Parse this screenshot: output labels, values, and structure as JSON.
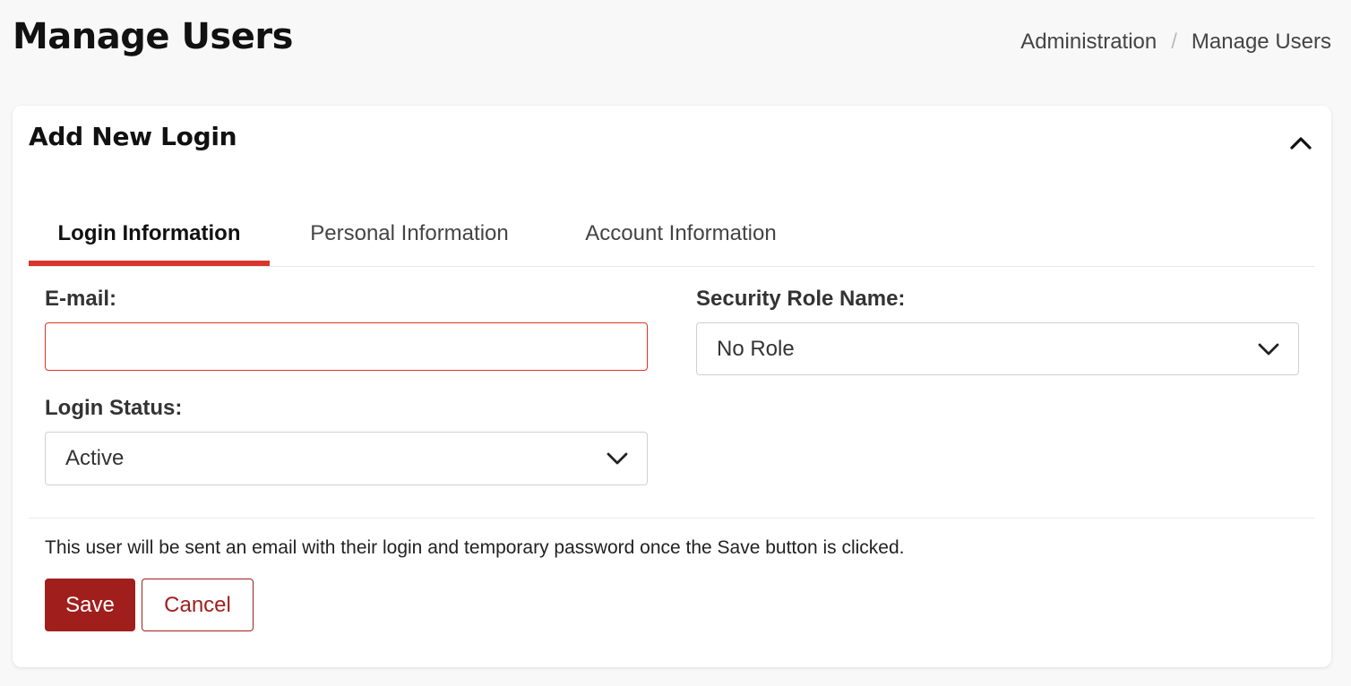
{
  "header": {
    "title": "Manage Users",
    "breadcrumb": {
      "items": [
        "Administration",
        "Manage Users"
      ],
      "separator": "/"
    }
  },
  "card": {
    "title": "Add New Login",
    "collapse_icon": "chevron-up-icon",
    "tabs": [
      {
        "label": "Login Information",
        "active": true
      },
      {
        "label": "Personal Information",
        "active": false
      },
      {
        "label": "Account Information",
        "active": false
      }
    ],
    "form": {
      "email": {
        "label": "E-mail:",
        "value": "",
        "placeholder": ""
      },
      "security_role": {
        "label": "Security Role Name:",
        "selected": "No Role"
      },
      "login_status": {
        "label": "Login Status:",
        "selected": "Active"
      }
    },
    "note": "This user will be sent an email with their login and temporary password once the Save button is clicked.",
    "buttons": {
      "save": "Save",
      "cancel": "Cancel"
    }
  },
  "colors": {
    "accent": "#d9352a",
    "primary_button": "#a01f1c",
    "background": "#f8f8f8"
  }
}
